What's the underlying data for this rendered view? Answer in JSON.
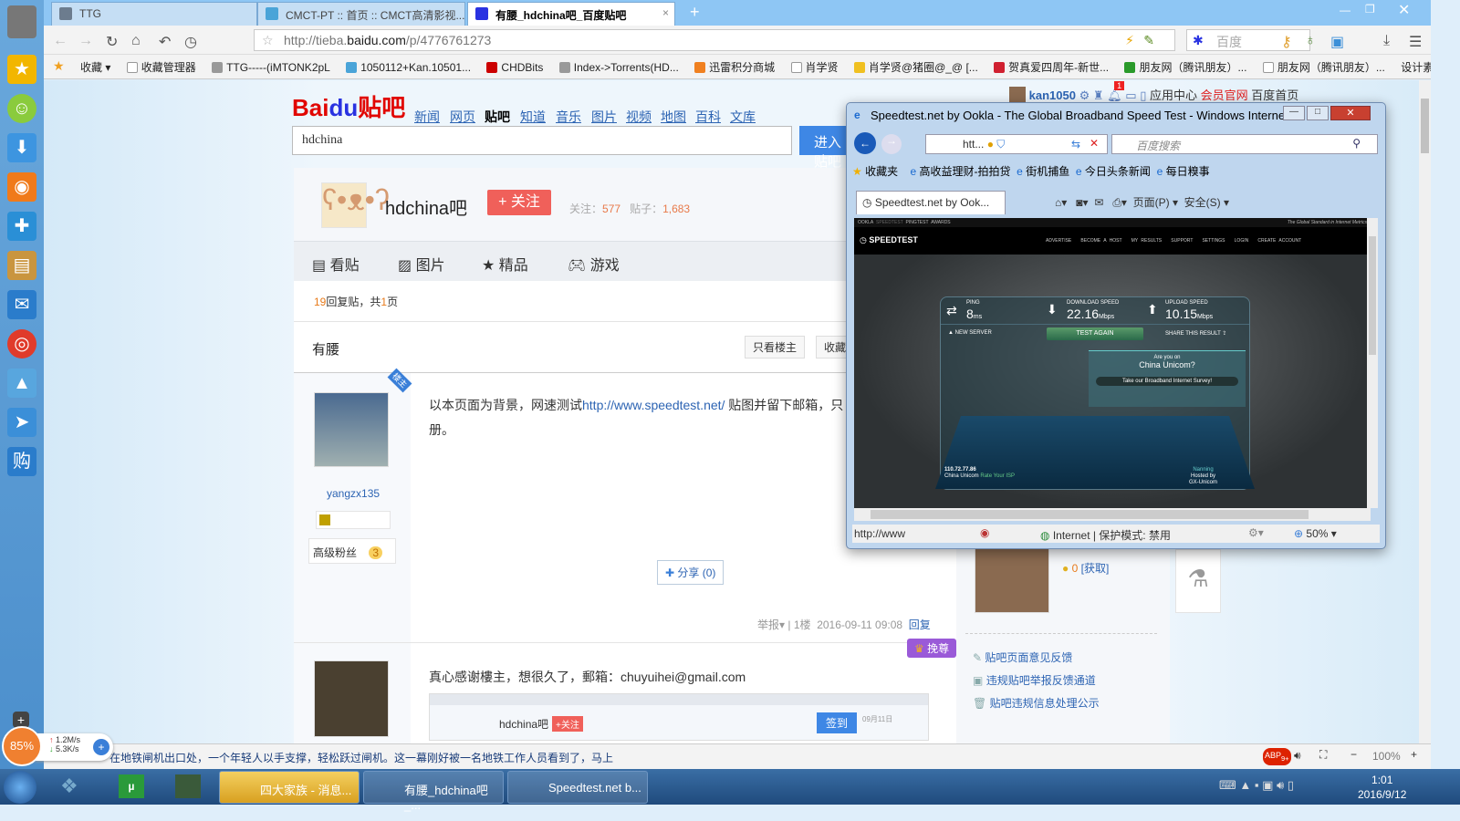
{
  "browser": {
    "tabs": [
      {
        "label": "TTG"
      },
      {
        "label": "CMCT-PT :: 首页 :: CMCT高清影视..."
      },
      {
        "label": "有腰_hdchina吧_百度贴吧"
      }
    ],
    "new_tab": "+",
    "url_prefix": "http://tieba.",
    "url_domain": "baidu.com",
    "url_path": "/p/4776761273",
    "search_placeholder": "百度",
    "bookmarks": [
      "收藏 ▾",
      "收藏管理器",
      "TTG-----(iMTONK2pL",
      "1050112+Kan.10501...",
      "CHDBits",
      "Index->Torrents(HD...",
      "迅雷积分商城",
      "肖学贤",
      "肖学贤@猪圈@_@ [...",
      "贺真爱四周年-新世...",
      "朋友网（腾讯朋友）...",
      "朋友网（腾讯朋友）...",
      "设计素"
    ],
    "status_news": "在地铁闸机出口处，一个年轻人以手支撑，轻松跃过闸机。这一幕刚好被一名地铁工作人员看到了，马上",
    "zoom": "100%",
    "abp_badge": "9+"
  },
  "speed_widget": {
    "percent": "85%",
    "up": "1.2M/s",
    "down": "5.3K/s"
  },
  "tieba": {
    "logo_text": "Bai",
    "logo_du": "du",
    "logo_tieba": "贴吧",
    "nav": [
      "新闻",
      "网页",
      "贴吧",
      "知道",
      "音乐",
      "图片",
      "视频",
      "地图",
      "百科",
      "文库"
    ],
    "search_value": "hdchina",
    "enter_btn": "进入贴吧",
    "user": {
      "name": "kan1050",
      "notif_count": "1",
      "app_center": "应用中心",
      "vip": "会员官网",
      "home": "百度首页"
    },
    "forum_name": "hdchina吧",
    "follow_btn": "+ 关注",
    "follow_label": "关注：",
    "follow_count": "577",
    "posts_label": "贴子：",
    "posts_count": "1,683",
    "tabs": [
      "看贴",
      "图片",
      "精品",
      "游戏"
    ],
    "reply_count": "19",
    "reply_text": "回复贴，共",
    "page_count": "1",
    "page_suffix": "页",
    "thread_title": "有腰",
    "only_op_btn": "只看楼主",
    "collect_btn": "收藏",
    "post1": {
      "badge": "楼主",
      "author": "yangzx135",
      "fan_level": "高级粉丝",
      "level": "3",
      "text_before": "以本页面为背景，网速测试",
      "link": "http://www.speedtest.net/",
      "text_after": "  贴图并留下邮箱，只",
      "text_line2": "册。",
      "share": "分享 (0)",
      "report": "举报▾",
      "floor": "1楼",
      "time": "2016-09-11 09:08",
      "reply": "回复"
    },
    "post2": {
      "text": "真心感谢樓主，想很久了，郵箱：chuyuihei@gmail.com",
      "mini_forum": "hdchina吧",
      "mini_follow": "+关注",
      "mini_sign": "签到",
      "mini_date": "09月11日"
    },
    "crown_tag": "挽尊",
    "side": {
      "coins": "0",
      "get": "[获取]",
      "links": [
        "贴吧页面意见反馈",
        "违规贴吧举报反馈通道",
        "贴吧违规信息处理公示"
      ]
    }
  },
  "ie": {
    "title": "Speedtest.net by Ookla - The Global Broadband Speed Test - Windows Interne...",
    "addr": "htt...",
    "search_placeholder": "百度搜索",
    "favorites": "收藏夹",
    "fav_links": [
      "高收益理财-拍拍贷",
      "街机捕鱼",
      "今日头条新闻",
      "每日糗事"
    ],
    "tab": "Speedtest.net by Ook...",
    "page_menu": "页面(P) ▾",
    "safety_menu": "安全(S) ▾",
    "status_url": "http://www",
    "zone": "Internet | 保护模式: 禁用",
    "zoom": "50%"
  },
  "speedtest": {
    "top_links": [
      "OOKLA",
      "SPEEDTEST",
      "PINGTEST",
      "AWARDS"
    ],
    "tagline": "The Global Standard in Internet Metrics",
    "brand": "SPEEDTEST",
    "menu": [
      "ADVERTISE",
      "BECOME A HOST",
      "MY RESULTS",
      "SUPPORT",
      "SETTINGS",
      "LOGIN",
      "CREATE ACCOUNT"
    ],
    "ping_label": "PING",
    "ping": "8",
    "ping_unit": "ms",
    "dl_label": "DOWNLOAD SPEED",
    "dl": "22.16",
    "ul_label": "UPLOAD SPEED",
    "ul": "10.15",
    "unit": "Mbps",
    "new_server": "NEW SERVER",
    "test_again": "TEST AGAIN",
    "share": "SHARE THIS RESULT",
    "survey_q1": "Are you on",
    "survey_q2": "China Unicom?",
    "survey_btn": "Take our Broadband Internet Survey!",
    "ip": "110.72.77.86",
    "isp": "China Unicom",
    "rate": "Rate Your ISP",
    "server": "Nanning",
    "hosted": "Hosted by",
    "host": "GX-Unicom"
  },
  "taskbar": {
    "items": [
      "四大家族 - 消息...",
      "有腰_hdchina吧_...",
      "Speedtest.net b..."
    ],
    "time": "1:01",
    "date": "2016/9/12"
  }
}
